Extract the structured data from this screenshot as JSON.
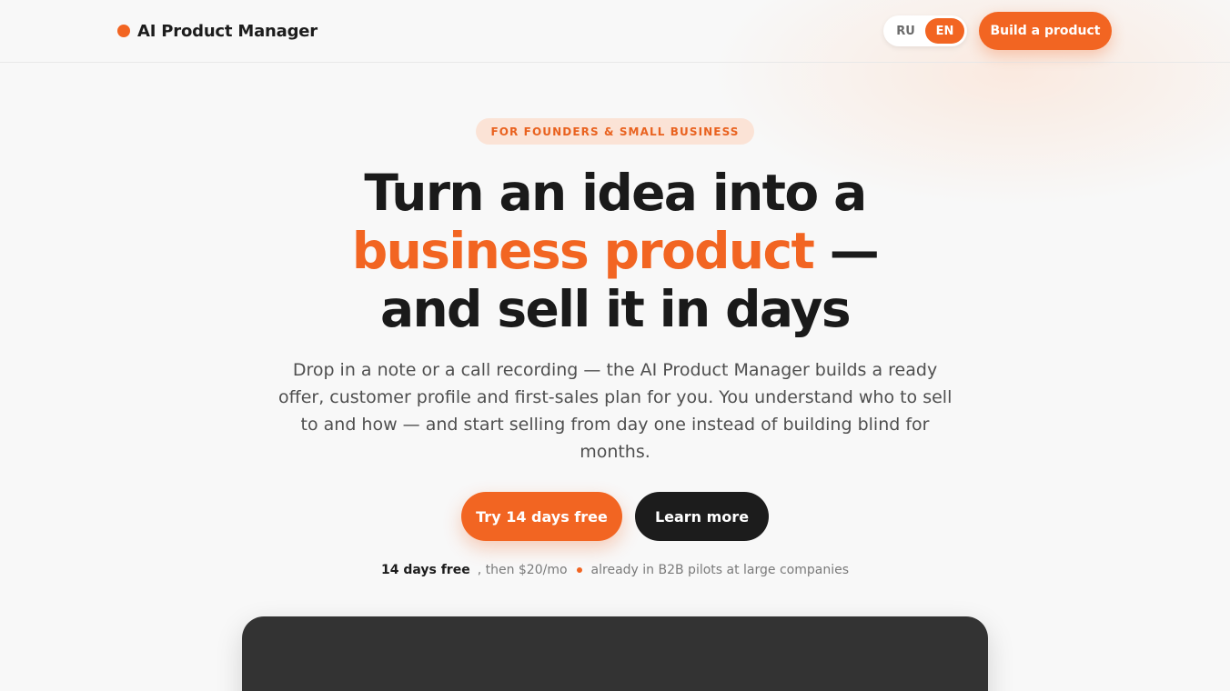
{
  "header": {
    "brand_name": "AI Product Manager",
    "brand_icon": "orange-dot",
    "languages": [
      "RU",
      "EN"
    ],
    "active_language": "EN",
    "cta_label": "Build a product"
  },
  "hero": {
    "tag": "FOR FOUNDERS & SMALL BUSINESS",
    "headline": {
      "line1": "Turn an idea into a",
      "line2_accent": "business product",
      "line2_rest": "—",
      "line3": "and sell it in days"
    },
    "subtext": {
      "line1": "Drop in a note or a call recording — the AI Product Manager builds a ready",
      "line2": "offer, customer profile and first-sales plan for you. You understand who to sell",
      "line3": "to and how — and start selling from day one instead of building blind for",
      "line4": "months."
    },
    "primary_button": "Try 14 days free",
    "secondary_button": "Learn more",
    "meta": {
      "trial": "14 days free",
      "price": ", then $20/mo",
      "social_proof": "already in B2B pilots at large companies"
    }
  },
  "colors": {
    "accent": "#f26522",
    "dark": "#1c1c1c",
    "background": "#f8f8f8",
    "tag_background": "#fbe3d6",
    "preview_panel": "#333333"
  }
}
